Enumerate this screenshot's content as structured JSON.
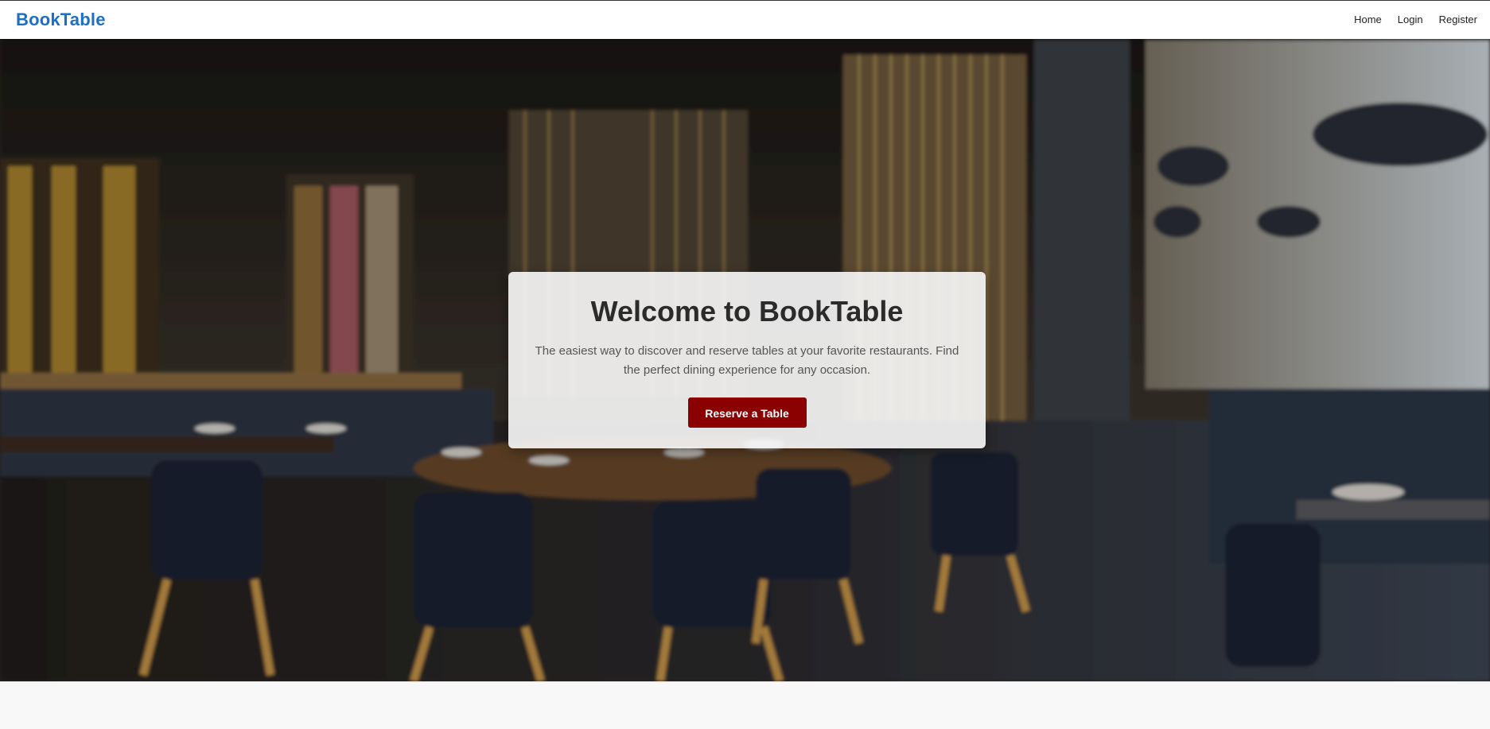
{
  "nav": {
    "brand": "BookTable",
    "links": [
      "Home",
      "Login",
      "Register"
    ]
  },
  "hero": {
    "title": "Welcome to BookTable",
    "subtitle": "The easiest way to discover and reserve tables at your favorite restaurants. Find the perfect dining experience for any occasion.",
    "cta_label": "Reserve a Table"
  },
  "colors": {
    "brand": "#1b6fc7",
    "cta": "#8b0000",
    "card_bg": "#f5f5f5"
  }
}
